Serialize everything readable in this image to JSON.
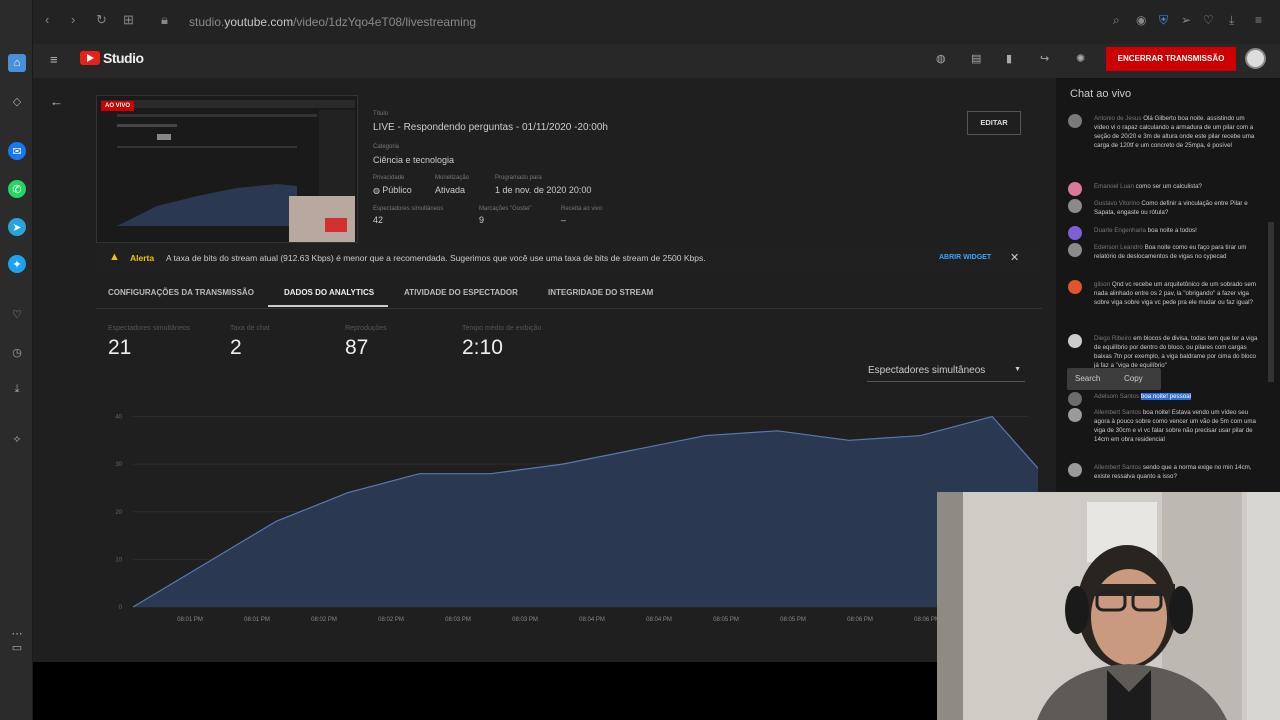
{
  "browser": {
    "url_prefix": "studio.",
    "url_domain": "youtube.com",
    "url_path": "/video/1dzYqo4eT08/livestreaming"
  },
  "header": {
    "brand": "Studio",
    "end_button": "ENCERRAR TRANSMISSÃO"
  },
  "stream": {
    "live_badge": "AO VIVO",
    "title_label": "Título",
    "title": "LIVE - Respondendo perguntas - 01/11/2020 -20:00h",
    "category_label": "Categoria",
    "category": "Ciência e tecnologia",
    "privacy_label": "Privacidade",
    "privacy": "Público",
    "monetization_label": "Monetização",
    "monetization": "Ativada",
    "scheduled_label": "Programado para",
    "scheduled": "1 de nov. de 2020 20:00",
    "viewers_label": "Espectadores simultâneos",
    "viewers": "42",
    "likes_label": "Marcações \"Gostei\"",
    "likes": "9",
    "chat_rate_label": "Receita ao vivo",
    "chat_rate": "–",
    "edit_button": "EDITAR"
  },
  "alert": {
    "label": "Alerta",
    "text": "A taxa de bits do stream atual (912.63 Kbps) é menor que a recomendada. Sugerimos que você use uma taxa de bits de stream de 2500 Kbps.",
    "action": "ABRIR WIDGET"
  },
  "tabs": [
    {
      "label": "CONFIGURAÇÕES DA TRANSMISSÃO"
    },
    {
      "label": "DADOS DO ANALYTICS"
    },
    {
      "label": "ATIVIDADE DO ESPECTADOR"
    },
    {
      "label": "INTEGRIDADE DO STREAM"
    }
  ],
  "stats": [
    {
      "label": "Espectadores simultâneos",
      "value": "21"
    },
    {
      "label": "Taxa de chat",
      "value": "2"
    },
    {
      "label": "Reproduções",
      "value": "87"
    },
    {
      "label": "Tempo médio de exibição",
      "value": "2:10"
    }
  ],
  "metric_select": "Espectadores simultâneos",
  "chart_data": {
    "type": "area",
    "x": [
      "08:01 PM",
      "08:01 PM",
      "08:02 PM",
      "08:02 PM",
      "08:03 PM",
      "08:03 PM",
      "08:04 PM",
      "08:04 PM",
      "08:05 PM",
      "08:05 PM",
      "08:06 PM",
      "08:06 PM"
    ],
    "series_points": [
      [
        0,
        0
      ],
      [
        1,
        9
      ],
      [
        2,
        18
      ],
      [
        3,
        24
      ],
      [
        4,
        28
      ],
      [
        5,
        28
      ],
      [
        6,
        30
      ],
      [
        7,
        33
      ],
      [
        8,
        36
      ],
      [
        9,
        37
      ],
      [
        10,
        35
      ],
      [
        11,
        36
      ],
      [
        12,
        40
      ],
      [
        13,
        23
      ]
    ],
    "y_ticks": [
      "0",
      "10",
      "20",
      "30",
      "40"
    ],
    "ylim": [
      0,
      42
    ],
    "color": "#2b3852",
    "line_color": "#5a78b0"
  },
  "chat": {
    "title": "Chat ao vivo",
    "messages": [
      {
        "author": "Antonio de Jesus",
        "text": "Olá Gilberto boa noite. assistindo um vídeo vi o rapaz calculando a armadura de um pilar com a seção de 20/20 e 3m de altura onde este pilar recebe uma carga de 120tf e um concreto de 25mpa, é posível"
      },
      {
        "author": "Emanoel Luan",
        "text": "como ser um calculista?"
      },
      {
        "author": "Gustavo Vitorino",
        "text": "Como definir a vinculação entre Pilar e Sapata, engaste ou rótula?"
      },
      {
        "author": "Duarte Engenharia",
        "text": "boa noite a todos!"
      },
      {
        "author": "Edenson Leandro",
        "text": "Boa noite como eu faço para tirar um relatório de deslocamentos de vigas no cypecad"
      },
      {
        "author": "gilson",
        "text": "Qnd vc recebe um arquitetônico de um sobrado sem nada alinhado entre os 2 pav, la \"obrigando\" a fazer viga sobre viga sobre viga vc pede pra ele mudar ou faz igual?"
      },
      {
        "author": "Diego Ribeiro",
        "text": "em blocos de divisa, todas tem que ter a viga de equilíbrio por dentro do bloco, ou pilares com cargas baixas 7tn por exemplo, a viga baldrame por cima do bloco já faz a \"viga de equilíbrio\""
      },
      {
        "author": "Adelsom Santos",
        "text": "boa noite! pessoal"
      },
      {
        "author": "Allembert Santos",
        "text": "boa noite! Estava vendo um vídeo seu agora à pouco sobre como vencer um vão de 5m com uma viga de 30cm e vi vc falar sobre não precisar usar pilar de 14cm em obra residencial"
      },
      {
        "author": "Allembert Santos",
        "text": "sendo que a norma exige no min 14cm, existe ressalva quanto a isso?"
      }
    ],
    "context_menu": [
      "Search",
      "Copy"
    ]
  }
}
